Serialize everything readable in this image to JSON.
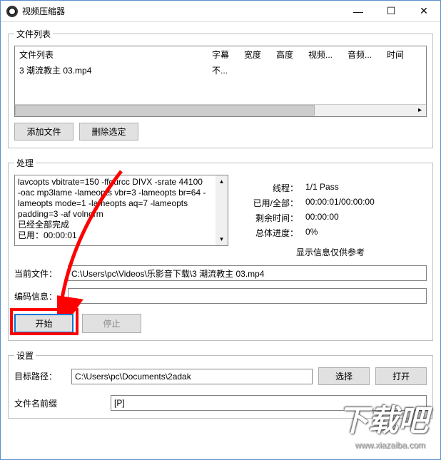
{
  "window": {
    "title": "视频压缩器",
    "minimize": "—",
    "maximize": "☐",
    "close": "✕"
  },
  "filelist": {
    "legend": "文件列表",
    "headers": {
      "name": "文件列表",
      "subtitle": "字幕",
      "width": "宽度",
      "height": "高度",
      "video": "视频...",
      "audio": "音频...",
      "time": "时间"
    },
    "rows": [
      {
        "name": "3 潮流教主 03.mp4",
        "subtitle": "不..."
      }
    ],
    "add_btn": "添加文件",
    "remove_btn": "删除选定"
  },
  "process": {
    "legend": "处理",
    "log_lines": [
      "lavcopts vbitrate=150  -ffourcc DIVX -srate 44100",
      "-oac mp3lame -lameopts vbr=3  -lameopts br=64 -",
      "lameopts mode=1 -lameopts aq=7 -lameopts",
      "padding=3 -af volnorm",
      "已经全部完成",
      "已用：00:00:01"
    ],
    "stats": {
      "threads_lbl": "线程：",
      "threads_val": "1/1 Pass",
      "used_lbl": "已用/全部：",
      "used_val": "00:00:01/00:00:00",
      "remain_lbl": "剩余时间：",
      "remain_val": "00:00:00",
      "progress_lbl": "总体进度：",
      "progress_val": "0%",
      "note": "显示信息仅供参考"
    },
    "current_file_lbl": "当前文件：",
    "current_file_val": "C:\\Users\\pc\\Videos\\乐影音下载\\3 潮流教主 03.mp4",
    "encode_lbl": "编码信息：",
    "encode_val": "",
    "start_btn": "开始",
    "stop_btn": "停止"
  },
  "settings": {
    "legend": "设置",
    "target_lbl": "目标路径：",
    "target_val": "C:\\Users\\pc\\Documents\\2adak",
    "select_btn": "选择",
    "open_btn": "打开",
    "prefix_lbl": "文件名前缀",
    "prefix_val": "[P]"
  },
  "watermark": {
    "main": "下载吧",
    "sub": "www.xiazaiba.com"
  }
}
